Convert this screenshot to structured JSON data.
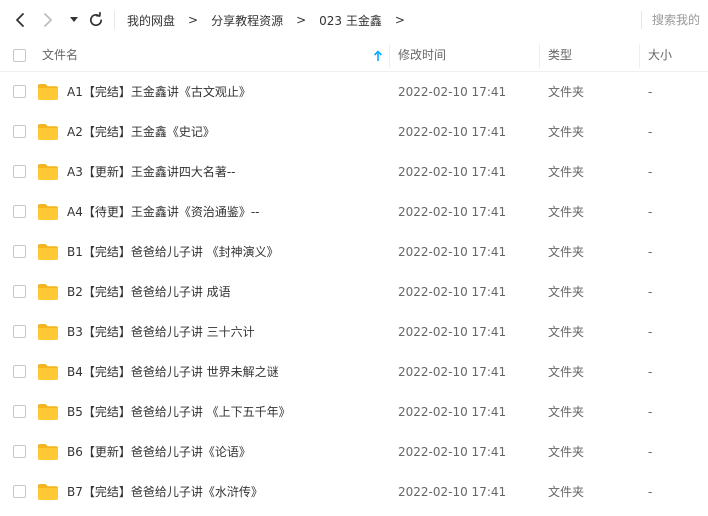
{
  "nav": {
    "back_icon": "chevron-left-icon",
    "forward_icon": "chevron-right-icon",
    "history_icon": "caret-down-icon",
    "refresh_icon": "refresh-icon"
  },
  "breadcrumb": {
    "items": [
      "我的网盘",
      "分享教程资源",
      "023 王金鑫"
    ],
    "separator": ">"
  },
  "search": {
    "placeholder": "搜索我的"
  },
  "table": {
    "headers": {
      "name": "文件名",
      "modified": "修改时间",
      "type": "类型",
      "size": "大小"
    },
    "sort_icon": "sort-up-arrow-icon",
    "rows": [
      {
        "name": "A1【完结】王金鑫讲《古文观止》",
        "modified": "2022-02-10 17:41",
        "type": "文件夹",
        "size": "-"
      },
      {
        "name": "A2【完结】王金鑫《史记》",
        "modified": "2022-02-10 17:41",
        "type": "文件夹",
        "size": "-"
      },
      {
        "name": "A3【更新】王金鑫讲四大名著--",
        "modified": "2022-02-10 17:41",
        "type": "文件夹",
        "size": "-"
      },
      {
        "name": "A4【待更】王金鑫讲《资治通鉴》--",
        "modified": "2022-02-10 17:41",
        "type": "文件夹",
        "size": "-"
      },
      {
        "name": "B1【完结】爸爸给儿子讲 《封神演义》",
        "modified": "2022-02-10 17:41",
        "type": "文件夹",
        "size": "-"
      },
      {
        "name": "B2【完结】爸爸给儿子讲 成语",
        "modified": "2022-02-10 17:41",
        "type": "文件夹",
        "size": "-"
      },
      {
        "name": "B3【完结】爸爸给儿子讲 三十六计",
        "modified": "2022-02-10 17:41",
        "type": "文件夹",
        "size": "-"
      },
      {
        "name": "B4【完结】爸爸给儿子讲 世界未解之谜",
        "modified": "2022-02-10 17:41",
        "type": "文件夹",
        "size": "-"
      },
      {
        "name": "B5【完结】爸爸给儿子讲 《上下五千年》",
        "modified": "2022-02-10 17:41",
        "type": "文件夹",
        "size": "-"
      },
      {
        "name": "B6【更新】爸爸给儿子讲《论语》",
        "modified": "2022-02-10 17:41",
        "type": "文件夹",
        "size": "-"
      },
      {
        "name": "B7【完结】爸爸给儿子讲《水浒传》",
        "modified": "2022-02-10 17:41",
        "type": "文件夹",
        "size": "-"
      }
    ]
  },
  "colors": {
    "folder": "#ffc935",
    "folder_tab": "#f5b51d",
    "sort_arrow": "#09aaff",
    "text": "#333333",
    "muted_text": "#666666"
  }
}
